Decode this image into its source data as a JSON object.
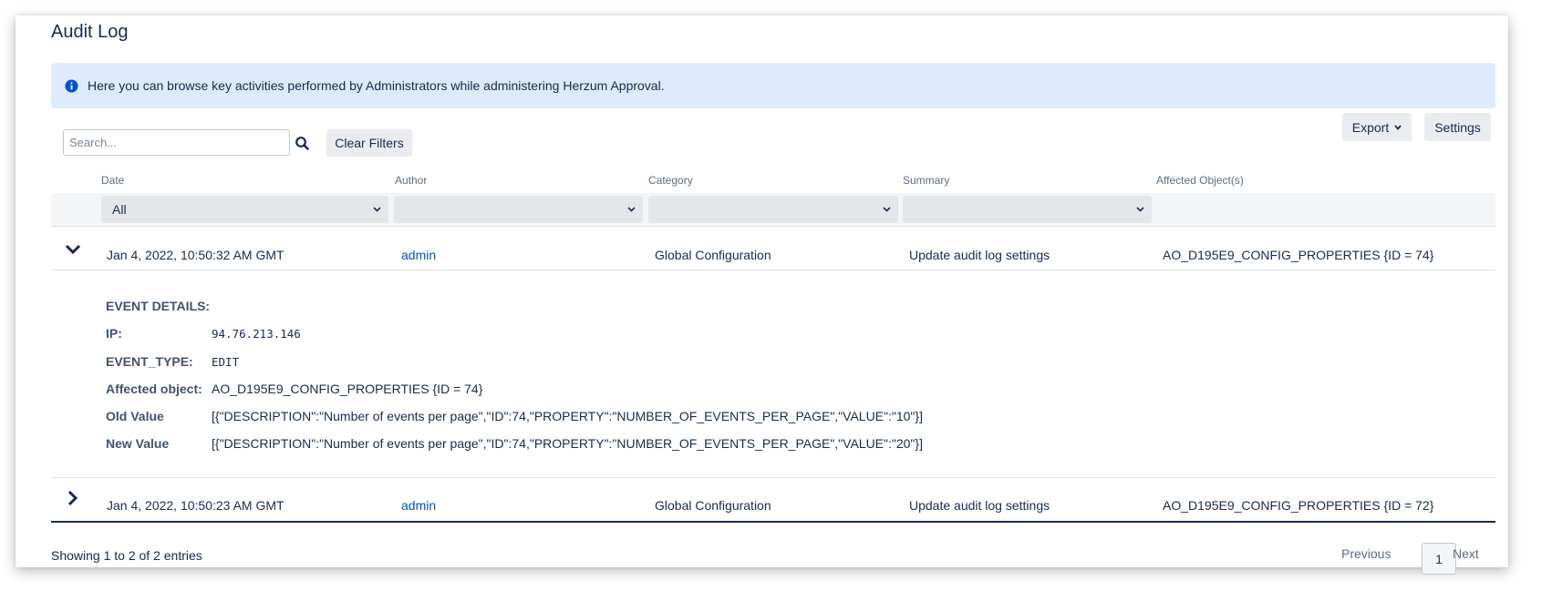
{
  "page": {
    "title": "Audit Log"
  },
  "info": {
    "message": "Here you can browse key activities performed by Administrators while administering Herzum Approval."
  },
  "toolbar": {
    "search_placeholder": "Search...",
    "clear_filters": "Clear Filters",
    "export": "Export",
    "settings": "Settings"
  },
  "table": {
    "headers": {
      "date": "Date",
      "author": "Author",
      "category": "Category",
      "summary": "Summary",
      "affected": "Affected Object(s)"
    },
    "filters": {
      "date": "All",
      "author": "",
      "category": "",
      "summary": ""
    },
    "rows": [
      {
        "date": "Jan 4, 2022, 10:50:32 AM GMT",
        "author": "admin",
        "category": "Global Configuration",
        "summary": "Update audit log settings",
        "affected": "AO_D195E9_CONFIG_PROPERTIES {ID = 74}",
        "expanded": true
      },
      {
        "date": "Jan 4, 2022, 10:50:23 AM GMT",
        "author": "admin",
        "category": "Global Configuration",
        "summary": "Update audit log settings",
        "affected": "AO_D195E9_CONFIG_PROPERTIES {ID = 72}",
        "expanded": false
      }
    ]
  },
  "details": {
    "heading": "EVENT DETAILS:",
    "ip_label": "IP:",
    "ip_value": "94.76.213.146",
    "event_type_label": "EVENT_TYPE:",
    "event_type_value": "EDIT",
    "affected_label": "Affected object:",
    "affected_value": "AO_D195E9_CONFIG_PROPERTIES {ID = 74}",
    "old_label": "Old Value",
    "old_value": "[{\"DESCRIPTION\":\"Number of events per page\",\"ID\":74,\"PROPERTY\":\"NUMBER_OF_EVENTS_PER_PAGE\",\"VALUE\":\"10\"}]",
    "new_label": "New Value",
    "new_value": "[{\"DESCRIPTION\":\"Number of events per page\",\"ID\":74,\"PROPERTY\":\"NUMBER_OF_EVENTS_PER_PAGE\",\"VALUE\":\"20\"}]"
  },
  "footer": {
    "showing": "Showing 1 to 2 of 2 entries",
    "previous": "Previous",
    "current_page": "1",
    "next": "Next"
  },
  "icons": {
    "info": "info-circle-icon",
    "search": "search-icon",
    "expanded": "chevron-down-icon",
    "collapsed": "chevron-right-icon",
    "dropdown": "chevron-down-small-icon"
  },
  "colors": {
    "info_bg": "#deebff",
    "link": "#0052cc",
    "text": "#172b4d",
    "muted": "#5e6c84",
    "button_bg": "#ebecf0",
    "info_icon": "#0052cc"
  }
}
